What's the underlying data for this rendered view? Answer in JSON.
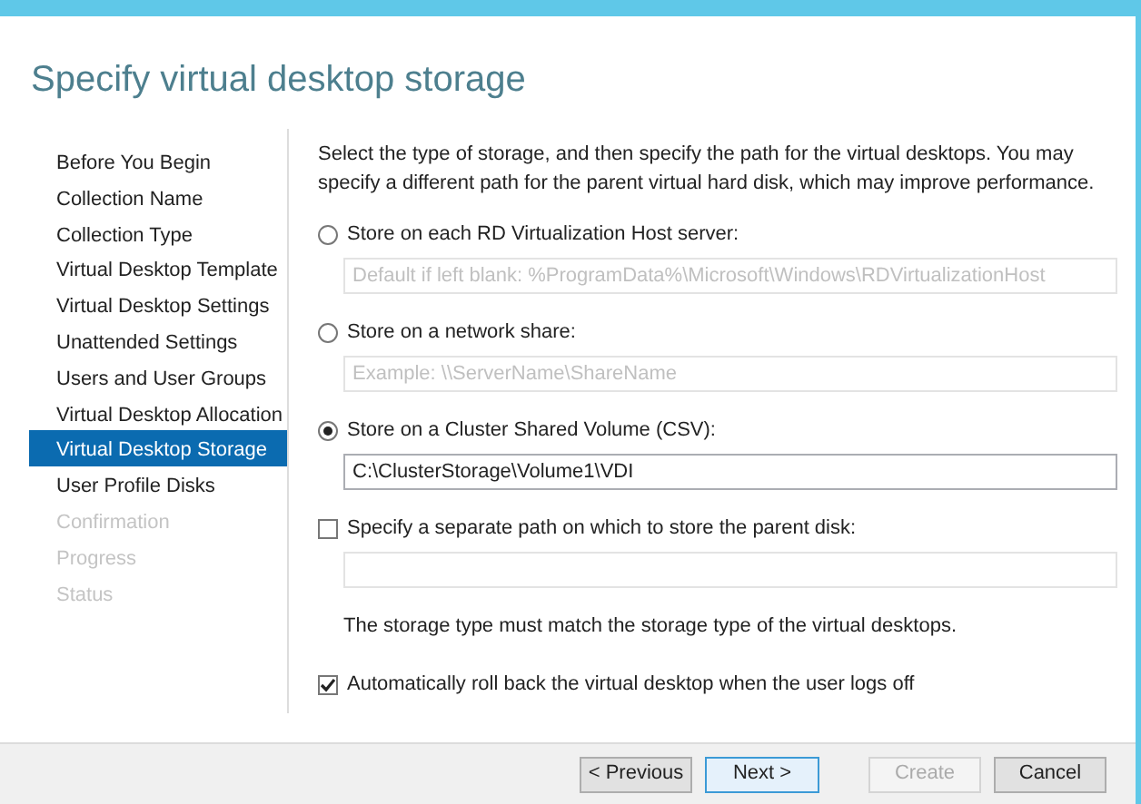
{
  "heading": "Specify virtual desktop storage",
  "steps": [
    {
      "label": "Before You Begin",
      "selected": false,
      "disabled": false
    },
    {
      "label": "Collection Name",
      "selected": false,
      "disabled": false
    },
    {
      "label": "Collection Type",
      "selected": false,
      "disabled": false
    },
    {
      "label": "Virtual Desktop Template",
      "selected": false,
      "disabled": false
    },
    {
      "label": "Virtual Desktop Settings",
      "selected": false,
      "disabled": false
    },
    {
      "label": "Unattended Settings",
      "selected": false,
      "disabled": false
    },
    {
      "label": "Users and User Groups",
      "selected": false,
      "disabled": false
    },
    {
      "label": "Virtual Desktop Allocation",
      "selected": false,
      "disabled": false
    },
    {
      "label": "Virtual Desktop Storage",
      "selected": true,
      "disabled": false
    },
    {
      "label": "User Profile Disks",
      "selected": false,
      "disabled": false
    },
    {
      "label": "Confirmation",
      "selected": false,
      "disabled": true
    },
    {
      "label": "Progress",
      "selected": false,
      "disabled": true
    },
    {
      "label": "Status",
      "selected": false,
      "disabled": true
    }
  ],
  "description": "Select the type of storage, and then specify the path for the virtual desktops. You may specify a different path for the parent virtual hard disk, which may improve performance.",
  "storage_options": [
    {
      "label": "Store on each RD Virtualization Host server:",
      "selected": false,
      "placeholder": "Default if left blank: %ProgramData%\\Microsoft\\Windows\\RDVirtualizationHost"
    },
    {
      "label": "Store on a network share:",
      "selected": false,
      "placeholder": "Example: \\\\ServerName\\ShareName"
    },
    {
      "label": "Store on a Cluster Shared Volume (CSV):",
      "selected": true,
      "value": "C:\\ClusterStorage\\Volume1\\VDI"
    }
  ],
  "parent_disk": {
    "label": "Specify a separate path on which to store the parent disk:",
    "checked": false
  },
  "note": "The storage type must match the storage type of the virtual desktops.",
  "rollback": {
    "label": "Automatically roll back the virtual desktop when the user logs off",
    "checked": true
  },
  "buttons": [
    {
      "label": "< Previous",
      "default": false,
      "disabled": false
    },
    {
      "label": "Next >",
      "default": true,
      "disabled": false
    },
    {
      "label": "Create",
      "default": false,
      "disabled": true
    },
    {
      "label": "Cancel",
      "default": false,
      "disabled": false
    }
  ]
}
